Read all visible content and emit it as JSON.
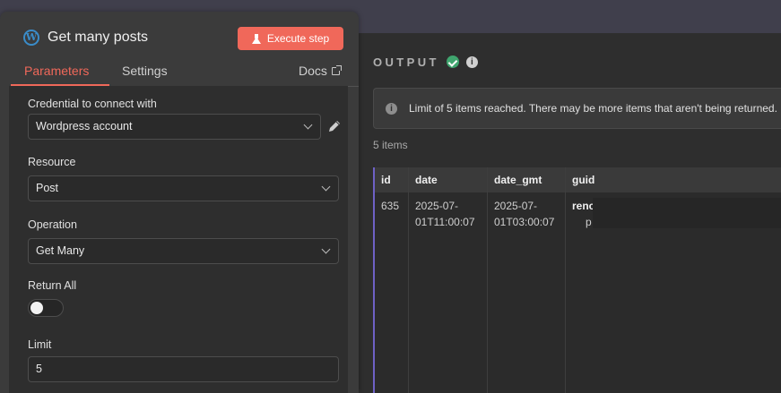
{
  "node": {
    "title": "Get many posts",
    "execute_label": "Execute step"
  },
  "tabs": {
    "parameters": "Parameters",
    "settings": "Settings",
    "docs": "Docs"
  },
  "form": {
    "credential_label": "Credential to connect with",
    "credential_value": "Wordpress account",
    "resource_label": "Resource",
    "resource_value": "Post",
    "operation_label": "Operation",
    "operation_value": "Get Many",
    "return_all_label": "Return All",
    "return_all_on": false,
    "limit_label": "Limit",
    "limit_value": "5"
  },
  "output": {
    "title": "OUTPUT",
    "notice": "Limit of 5 items reached. There may be more items that aren't being returned.",
    "items_count": "5 items",
    "columns": [
      "id",
      "date",
      "date_gmt",
      "guid"
    ],
    "row": {
      "id": "635",
      "date_line1": "2025-07-",
      "date_line2": "01T11:00:07",
      "gmt_line1": "2025-07-",
      "gmt_line2": "01T03:00:07",
      "guid_key": "renc",
      "guid_sub": "p"
    }
  },
  "colors": {
    "accent": "#f0685a",
    "success": "#3fa56e",
    "selected_row": "#6e61c5"
  }
}
